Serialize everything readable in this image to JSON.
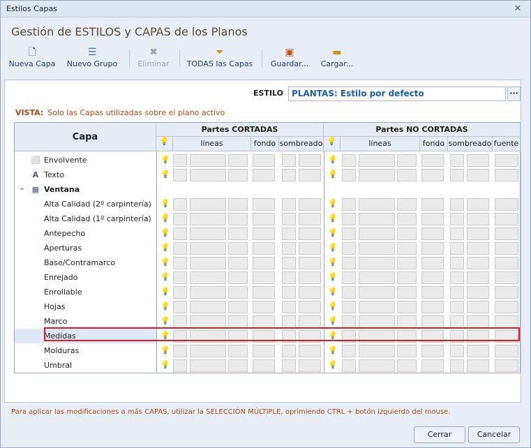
{
  "window": {
    "title": "Estilos Capas",
    "close": "✕"
  },
  "heading": "Gestión de ESTILOS y CAPAS de los Planos",
  "toolbar": [
    {
      "label": "Nueva Capa",
      "icon": "new-layer-icon",
      "disabled": false
    },
    {
      "label": "Nuevo Grupo",
      "icon": "new-group-icon",
      "disabled": false
    },
    {
      "label": "Eliminar",
      "icon": "delete-icon",
      "disabled": true
    },
    {
      "label": "TODAS las Capas",
      "icon": "filter-icon",
      "disabled": false
    },
    {
      "label": "Guardar...",
      "icon": "save-icon",
      "disabled": false
    },
    {
      "label": "Cargar...",
      "icon": "folder-icon",
      "disabled": false
    }
  ],
  "estilo": {
    "label": "ESTILO",
    "value": "PLANTAS: Estilo por defecto",
    "button": "···"
  },
  "vista": {
    "label": "VISTA:",
    "text": "Solo las Capas utilizadas sobre el plano activo"
  },
  "grid": {
    "col_capa": "Capa",
    "group_cortadas": "Partes CORTADAS",
    "group_no_cortadas": "Partes NO CORTADAS",
    "sub_cortadas": [
      "líneas",
      "fondo",
      "sombreado"
    ],
    "sub_no_cortadas": [
      "líneas",
      "fondo",
      "sombreado",
      "fuente"
    ]
  },
  "rows": [
    {
      "name": "Envolvente",
      "level": 0,
      "icon": "envelope-icon",
      "bulb_c": "on",
      "bulb_nc": "on",
      "spacer": false,
      "selected": false
    },
    {
      "name": "Texto",
      "level": 0,
      "icon": "text-icon",
      "bulb_c": "on",
      "bulb_nc": "on",
      "spacer": false,
      "selected": false
    },
    {
      "name": "Ventana",
      "level": 0,
      "icon": "window-icon",
      "bold": true,
      "group": true,
      "spacer": true,
      "selected": false
    },
    {
      "name": "Alta Calidad  (2º carpintería)",
      "level": 1,
      "bulb_c": "off",
      "bulb_nc": "off",
      "spacer": false,
      "selected": false
    },
    {
      "name": "Alta Calidad  (1º carpintería)",
      "level": 1,
      "bulb_c": "off",
      "bulb_nc": "off",
      "spacer": false,
      "selected": false
    },
    {
      "name": "Antepecho",
      "level": 1,
      "bulb_c": "on",
      "bulb_nc": "on",
      "spacer": false,
      "selected": false
    },
    {
      "name": "Aperturas",
      "level": 1,
      "bulb_c": "on",
      "bulb_nc": "on",
      "spacer": false,
      "selected": false
    },
    {
      "name": "Base/Contramarco",
      "level": 1,
      "bulb_c": "off",
      "bulb_nc": "off",
      "spacer": false,
      "selected": false
    },
    {
      "name": "Enrejado",
      "level": 1,
      "bulb_c": "off",
      "bulb_nc": "off",
      "spacer": false,
      "selected": false
    },
    {
      "name": "Enrollable",
      "level": 1,
      "bulb_c": "off",
      "bulb_nc": "off",
      "spacer": false,
      "selected": false
    },
    {
      "name": "Hojas",
      "level": 1,
      "bulb_c": "on",
      "bulb_nc": "off",
      "spacer": false,
      "selected": false
    },
    {
      "name": "Marco",
      "level": 1,
      "bulb_c": "on",
      "bulb_nc": "on",
      "spacer": false,
      "selected": false
    },
    {
      "name": "Medidas",
      "level": 1,
      "bulb_c": "on",
      "bulb_nc": "off",
      "spacer": false,
      "selected": true
    },
    {
      "name": "Molduras",
      "level": 1,
      "bulb_c": "off",
      "bulb_nc": "off",
      "spacer": false,
      "selected": false
    },
    {
      "name": "Umbral",
      "level": 1,
      "bulb_c": "off",
      "bulb_nc": "off",
      "spacer": false,
      "selected": false
    }
  ],
  "hint": "Para aplicar las modificaciones a más CAPAS, utilizar la SELECCIÓN MÚLTIPLE, oprimiendo CTRL + botón izquierdo del mouse.",
  "buttons": {
    "close": "Cerrar",
    "cancel": "Cancelar"
  },
  "colors": {
    "highlight": "#e01b24",
    "accent": "#1f5fa8",
    "warn_text": "#a84a14"
  }
}
